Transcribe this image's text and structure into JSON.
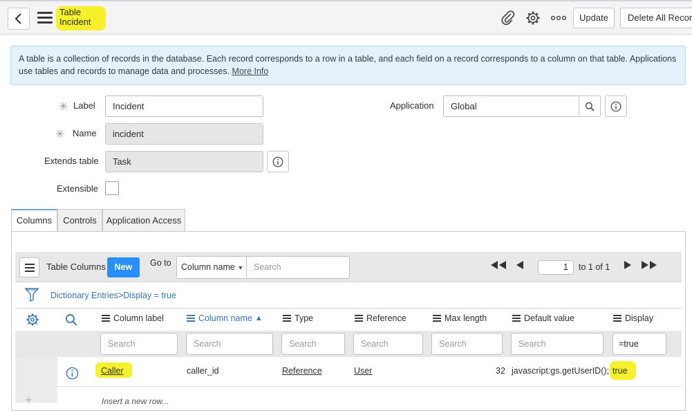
{
  "header": {
    "title_line1": "Table",
    "title_line2": "Incident",
    "update_label": "Update",
    "delete_label": "Delete All Records"
  },
  "banner": {
    "text": "A table is a collection of records in the database. Each record corresponds to a row in a table, and each field on a record corresponds to a column on that table. Applications use tables and records to manage data and processes.",
    "link": "More Info"
  },
  "form": {
    "label_label": "Label",
    "label_value": "Incident",
    "name_label": "Name",
    "name_value": "incident",
    "extends_label": "Extends table",
    "extends_value": "Task",
    "extensible_label": "Extensible",
    "application_label": "Application",
    "application_value": "Global"
  },
  "tabs": [
    "Columns",
    "Controls",
    "Application Access"
  ],
  "list": {
    "title": "Table Columns",
    "new_label": "New",
    "goto_label": "Go to",
    "goto_field": "Column name",
    "search_placeholder": "Search",
    "page_value": "1",
    "page_text": "to 1 of 1",
    "breadcrumb_root": "Dictionary Entries",
    "breadcrumb_sep": ">",
    "breadcrumb_filter": "Display = true",
    "columns": [
      "Column label",
      "Column name",
      "Type",
      "Reference",
      "Max length",
      "Default value",
      "Display"
    ],
    "search_filters": [
      "Search",
      "Search",
      "Search",
      "Search",
      "Search",
      "Search",
      "=true"
    ],
    "rows": [
      {
        "column_label": "Caller",
        "column_name": "caller_id",
        "type": "Reference",
        "reference": "User",
        "max_length": "32",
        "default_value": "javascript:gs.getUserID();",
        "display": "true"
      }
    ],
    "insert_row": "Insert a new row..."
  },
  "colors": {
    "highlight": "#f6f12a",
    "accent": "#278efc",
    "link": "#3a76b5",
    "banner_bg": "#e5f1fa"
  },
  "icons": [
    "back-icon",
    "menu-icon",
    "paperclip-icon",
    "gear-icon",
    "more-icon",
    "search-icon",
    "info-icon",
    "filter-icon",
    "first-page-icon",
    "prev-page-icon",
    "next-page-icon",
    "last-page-icon"
  ]
}
